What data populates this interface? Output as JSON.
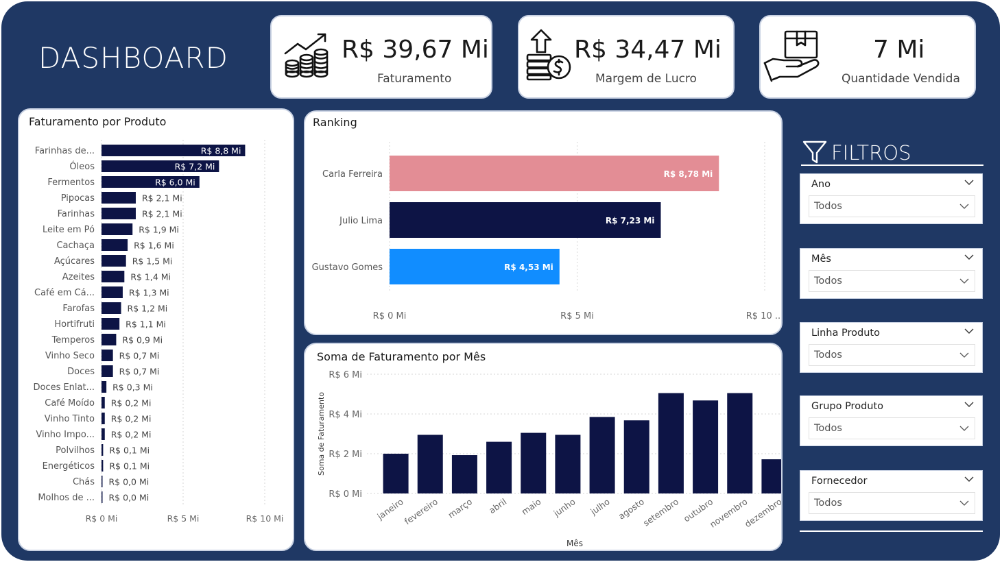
{
  "title": "DASHBOARD",
  "kpis": [
    {
      "value": "R$ 39,67 Mi",
      "label": "Faturamento",
      "icon": "coins-growth-icon"
    },
    {
      "value": "R$ 34,47 Mi",
      "label": "Margem de Lucro",
      "icon": "money-up-icon"
    },
    {
      "value": "7 Mi",
      "label": "Quantidade Vendida",
      "icon": "hand-box-icon"
    }
  ],
  "filters": {
    "title": "FILTROS",
    "slicers": [
      {
        "label": "Ano",
        "value": "Todos"
      },
      {
        "label": "Mês",
        "value": "Todos"
      },
      {
        "label": "Linha Produto",
        "value": "Todos"
      },
      {
        "label": "Grupo Produto",
        "value": "Todos"
      },
      {
        "label": "Fornecedor",
        "value": "Todos"
      }
    ]
  },
  "colors": {
    "background": "#1f3864",
    "bar": "#0d1445",
    "pink": "#e38d95",
    "blue": "#118dff"
  },
  "chart_data": [
    {
      "type": "bar",
      "orientation": "horizontal",
      "title": "Faturamento por Produto",
      "categories": [
        "Farinhas de...",
        "Óleos",
        "Fermentos",
        "Pipocas",
        "Farinhas",
        "Leite em Pó",
        "Cachaça",
        "Açúcares",
        "Azeites",
        "Café em Cá...",
        "Farofas",
        "Hortifruti",
        "Temperos",
        "Vinho Seco",
        "Doces",
        "Doces Enlat...",
        "Café Moído",
        "Vinho Tinto",
        "Vinho Impo...",
        "Polvilhos",
        "Energéticos",
        "Chás",
        "Molhos de ..."
      ],
      "values": [
        8.8,
        7.2,
        6.0,
        2.1,
        2.1,
        1.9,
        1.6,
        1.5,
        1.4,
        1.3,
        1.2,
        1.1,
        0.9,
        0.7,
        0.7,
        0.3,
        0.2,
        0.2,
        0.2,
        0.1,
        0.1,
        0.0,
        0.0
      ],
      "data_labels": [
        "R$ 8,8 Mi",
        "R$ 7,2 Mi",
        "R$ 6,0 Mi",
        "R$ 2,1 Mi",
        "R$ 2,1 Mi",
        "R$ 1,9 Mi",
        "R$ 1,6 Mi",
        "R$ 1,5 Mi",
        "R$ 1,4 Mi",
        "R$ 1,3 Mi",
        "R$ 1,2 Mi",
        "R$ 1,1 Mi",
        "R$ 0,9 Mi",
        "R$ 0,7 Mi",
        "R$ 0,7 Mi",
        "R$ 0,3 Mi",
        "R$ 0,2 Mi",
        "R$ 0,2 Mi",
        "R$ 0,2 Mi",
        "R$ 0,1 Mi",
        "R$ 0,1 Mi",
        "R$ 0,0 Mi",
        "R$ 0,0 Mi"
      ],
      "xlim": [
        0,
        10
      ],
      "xticks": [
        0,
        5,
        10
      ],
      "xtick_labels": [
        "R$ 0 Mi",
        "R$ 5 Mi",
        "R$ 10 Mi"
      ],
      "grid": true
    },
    {
      "type": "bar",
      "orientation": "horizontal",
      "title": "Ranking",
      "categories": [
        "Carla Ferreira",
        "Julio Lima",
        "Gustavo Gomes"
      ],
      "values": [
        8.78,
        7.23,
        4.53
      ],
      "data_labels": [
        "R$ 8,78 Mi",
        "R$ 7,23 Mi",
        "R$ 4,53 Mi"
      ],
      "colors": [
        "#e38d95",
        "#0d1445",
        "#118dff"
      ],
      "xlim": [
        0,
        10
      ],
      "xticks": [
        0,
        5,
        10
      ],
      "xtick_labels": [
        "R$ 0 Mi",
        "R$ 5 Mi",
        "R$ 10 ..."
      ],
      "grid": true
    },
    {
      "type": "bar",
      "title": "Soma de Faturamento por Mês",
      "xlabel": "Mês",
      "ylabel": "Soma de Faturamento",
      "categories": [
        "janeiro",
        "fevereiro",
        "março",
        "abril",
        "maio",
        "junho",
        "julho",
        "agosto",
        "setembro",
        "outubro",
        "novembro",
        "dezembro"
      ],
      "values": [
        2.0,
        2.95,
        1.93,
        2.6,
        3.05,
        2.95,
        3.85,
        3.68,
        5.05,
        4.68,
        5.05,
        1.72
      ],
      "ylim": [
        0,
        6
      ],
      "yticks": [
        0,
        2,
        4,
        6
      ],
      "ytick_labels": [
        "R$ 0 Mi",
        "R$ 2 Mi",
        "R$ 4 Mi",
        "R$ 6 Mi"
      ],
      "grid": true
    }
  ]
}
